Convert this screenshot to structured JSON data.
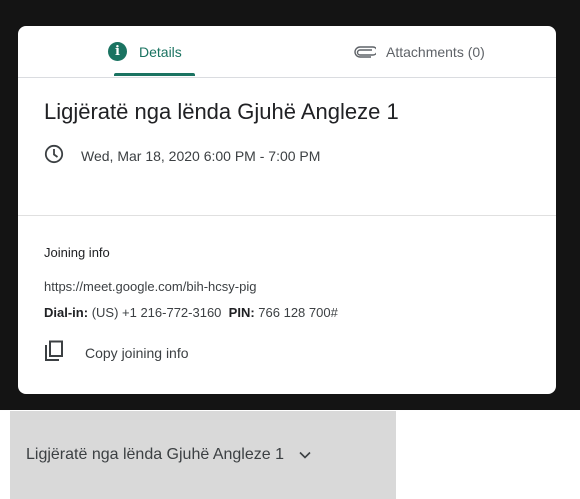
{
  "tabs": {
    "details_label": "Details",
    "attachments_label": "Attachments (0)"
  },
  "event": {
    "title": "Ligjëratë nga lënda Gjuhë Angleze 1",
    "datetime": "Wed, Mar 18, 2020 6:00 PM - 7:00 PM"
  },
  "joining": {
    "heading": "Joining info",
    "url": "https://meet.google.com/bih-hcsy-pig",
    "dial_label": "Dial-in:",
    "dial_value": "(US) +1 216-772-3160",
    "pin_label": "PIN:",
    "pin_value": "766 128 700#",
    "copy_label": "Copy joining info"
  },
  "footer": {
    "title": "Ligjëratë nga lënda Gjuhë Angleze 1"
  },
  "icons": {
    "details": "info-icon",
    "attachments": "paperclip-icon",
    "time": "clock-icon",
    "copy": "copy-icon",
    "expand": "chevron-down-icon"
  },
  "colors": {
    "accent": "#1a7361",
    "backdrop": "#141414",
    "footer_bg": "#d9d9d9"
  }
}
